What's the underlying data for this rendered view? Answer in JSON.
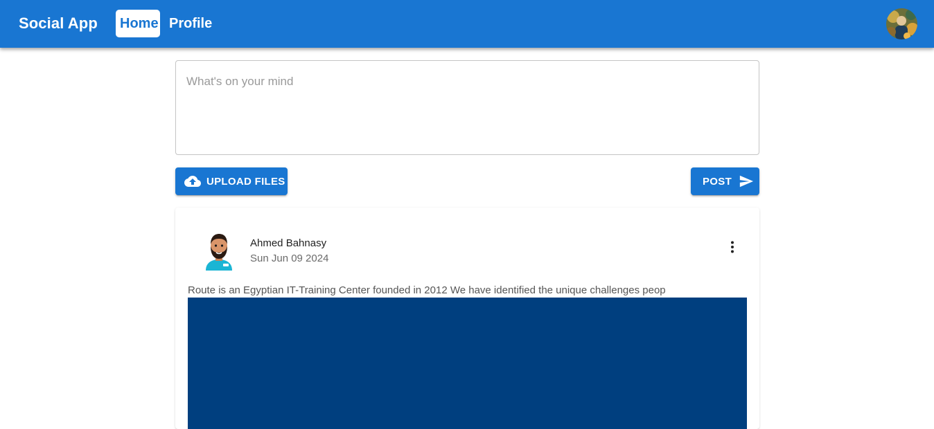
{
  "appbar": {
    "brand": "Social App",
    "nav": [
      {
        "label": "Home",
        "active": true
      },
      {
        "label": "Profile",
        "active": false
      }
    ],
    "colors": {
      "primary": "#1976d2"
    }
  },
  "composer": {
    "placeholder": "What's on your mind",
    "upload_label": "UPLOAD FILES",
    "upload_icon": "cloud-upload-icon",
    "post_label": "POST",
    "post_icon": "send-icon"
  },
  "post": {
    "author": "Ahmed Bahnasy",
    "date": "Sun Jun 09 2024",
    "body": "Route is an Egyptian IT-Training Center founded in 2012 We have identified the unique challenges peop",
    "menu_icon": "more-vertical-icon",
    "image_color": "#003f7f"
  }
}
